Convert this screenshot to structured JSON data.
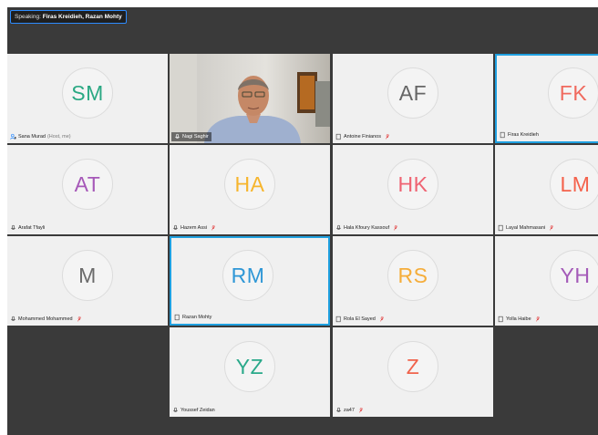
{
  "speaking": {
    "label": "Speaking: ",
    "names": "Firas Kreidieh, Razan Mohty"
  },
  "participants": [
    {
      "name": "Sana Murad",
      "suffix": "(Host, me)",
      "initials": "SM",
      "color": "#2aa883",
      "device": "host-icon",
      "muted": false,
      "video": false,
      "active": false
    },
    {
      "name": "Nagi Saghir",
      "suffix": "",
      "initials": "",
      "color": "#ffffff",
      "device": "phone-icon",
      "muted": false,
      "video": true,
      "active": false
    },
    {
      "name": "Antoine Finianos",
      "suffix": "",
      "initials": "AF",
      "color": "#666666",
      "device": "window-icon",
      "muted": true,
      "video": false,
      "active": false
    },
    {
      "name": "Firas Kreidieh",
      "suffix": "",
      "initials": "FK",
      "color": "#f06a5e",
      "device": "window-icon",
      "muted": false,
      "video": false,
      "active": true
    },
    {
      "name": "Arafat Tfayli",
      "suffix": "",
      "initials": "AT",
      "color": "#a658b8",
      "device": "phone-icon",
      "muted": false,
      "video": false,
      "active": false
    },
    {
      "name": "Hazem Assi",
      "suffix": "",
      "initials": "HA",
      "color": "#f6b52d",
      "device": "phone-icon",
      "muted": true,
      "video": false,
      "active": false
    },
    {
      "name": "Hala Kfoury Kassouf",
      "suffix": "",
      "initials": "HK",
      "color": "#ef6372",
      "device": "phone-icon",
      "muted": true,
      "video": false,
      "active": false
    },
    {
      "name": "Layal Mahmasani",
      "suffix": "",
      "initials": "LM",
      "color": "#f4624c",
      "device": "window-icon",
      "muted": true,
      "video": false,
      "active": false
    },
    {
      "name": "Mohammed Mohammed",
      "suffix": "",
      "initials": "M",
      "color": "#6b6b6b",
      "device": "phone-icon",
      "muted": true,
      "video": false,
      "active": false
    },
    {
      "name": "Razan Mohty",
      "suffix": "",
      "initials": "RM",
      "color": "#2f97d6",
      "device": "window-icon",
      "muted": false,
      "video": false,
      "active": true
    },
    {
      "name": "Rola El Sayed",
      "suffix": "",
      "initials": "RS",
      "color": "#f5ad3a",
      "device": "window-icon",
      "muted": true,
      "video": false,
      "active": false
    },
    {
      "name": "Yolla Haibe",
      "suffix": "",
      "initials": "YH",
      "color": "#a45ab8",
      "device": "window-icon",
      "muted": true,
      "video": false,
      "active": false
    },
    {
      "name": "Youssef Zeidan",
      "suffix": "",
      "initials": "YZ",
      "color": "#2aa98a",
      "device": "phone-icon",
      "muted": false,
      "video": false,
      "active": false
    },
    {
      "name": "za47",
      "suffix": "",
      "initials": "Z",
      "color": "#f0634c",
      "device": "phone-icon",
      "muted": true,
      "video": false,
      "active": false
    }
  ]
}
